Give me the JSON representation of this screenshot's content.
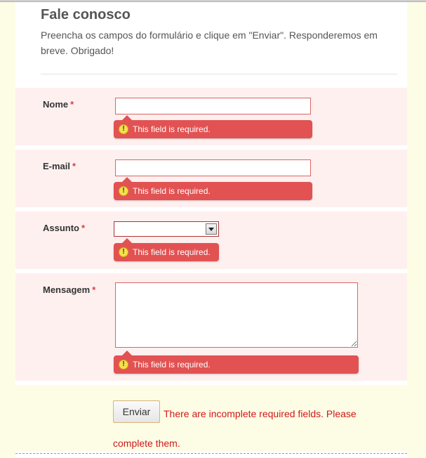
{
  "form": {
    "title": "Fale conosco",
    "description": "Preencha os campos do formulário e clique em \"Enviar\". Responderemos em breve. Obrigado!"
  },
  "fields": {
    "name": {
      "label": "Nome",
      "required_mark": "*",
      "value": "",
      "error": "This field is required."
    },
    "email": {
      "label": "E-mail",
      "required_mark": "*",
      "value": "",
      "error": "This field is required."
    },
    "subject": {
      "label": "Assunto",
      "required_mark": "*",
      "selected": "",
      "error": "This field is required."
    },
    "message": {
      "label": "Mensagem",
      "required_mark": "*",
      "value": "",
      "error": "This field is required."
    }
  },
  "submit": {
    "label": "Enviar",
    "message": "There are incomplete required fields. Please complete them."
  },
  "colors": {
    "error_bg": "#e25252",
    "row_bg": "#fff0f0",
    "page_bg": "#fdfde6",
    "error_text": "#d01818"
  }
}
